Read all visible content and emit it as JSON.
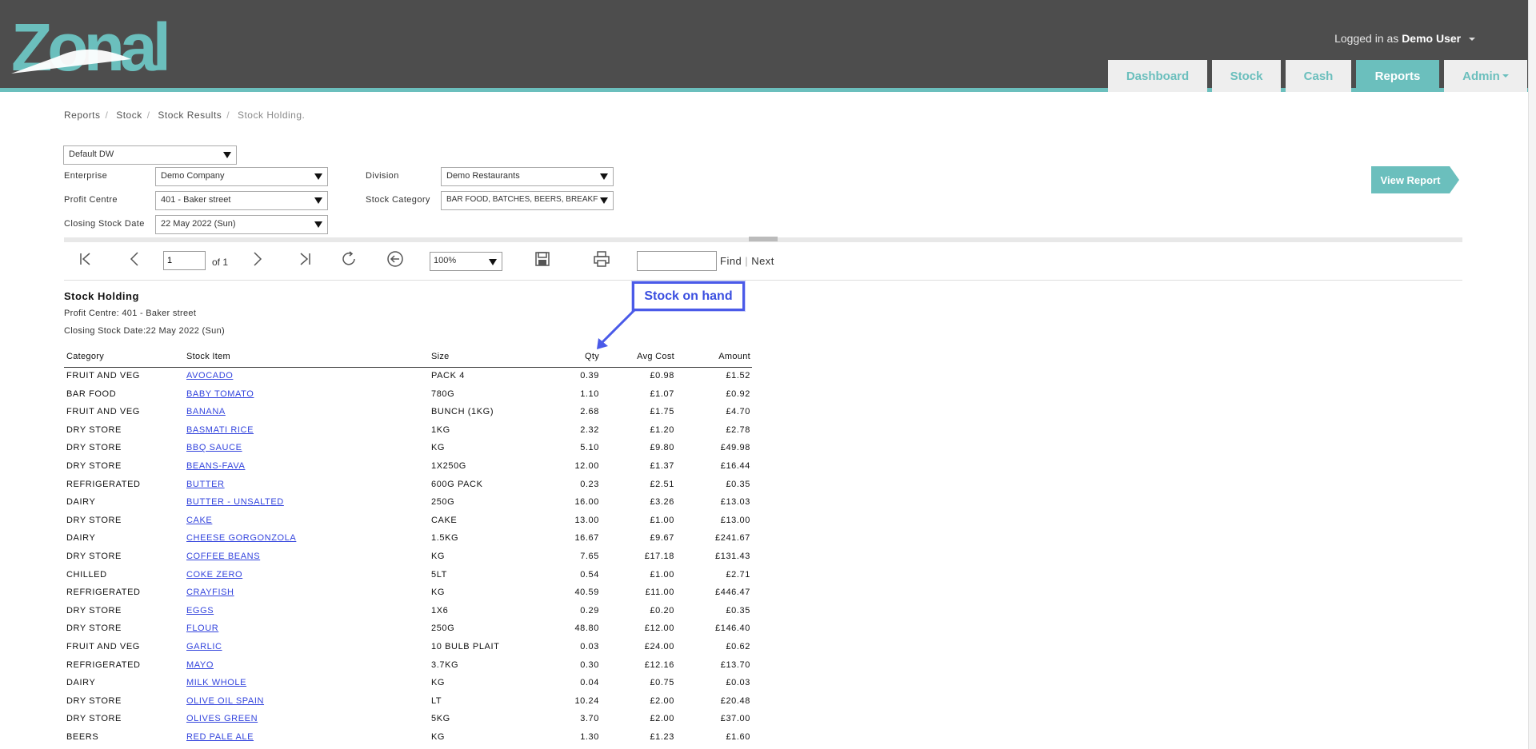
{
  "header": {
    "logo_text": "Zonal",
    "user_prefix": "Logged in as",
    "user_name": "Demo User",
    "tabs": [
      {
        "label": "Dashboard"
      },
      {
        "label": "Stock"
      },
      {
        "label": "Cash"
      },
      {
        "label": "Reports"
      },
      {
        "label": "Admin"
      }
    ]
  },
  "breadcrumb": {
    "items": [
      "Reports",
      "Stock",
      "Stock Results"
    ],
    "current": "Stock Holding."
  },
  "filters": {
    "datasource": "Default DW",
    "enterprise_label": "Enterprise",
    "enterprise_value": "Demo Company",
    "division_label": "Division",
    "division_value": "Demo Restaurants",
    "profit_centre_label": "Profit Centre",
    "profit_centre_value": "401 - Baker street",
    "stock_category_label": "Stock Category",
    "stock_category_value": "BAR FOOD, BATCHES, BEERS, BREAKF",
    "closing_date_label": "Closing Stock Date",
    "closing_date_value": "22 May 2022 (Sun)",
    "view_report_label": "View Report"
  },
  "toolbar": {
    "page_value": "1",
    "of_text": "of 1",
    "zoom_value": "100%",
    "find_value": "",
    "find_label": "Find",
    "next_label": "Next"
  },
  "report": {
    "title": "Stock Holding",
    "profit_centre_line": "Profit Centre: 401 - Baker street",
    "closing_date_line": "Closing Stock Date:22 May 2022 (Sun)",
    "columns": {
      "category": "Category",
      "item": "Stock Item",
      "size": "Size",
      "qty": "Qty",
      "avg_cost": "Avg Cost",
      "amount": "Amount"
    },
    "rows": [
      {
        "category": "FRUIT AND VEG",
        "item": "AVOCADO",
        "size": "PACK 4",
        "qty": "0.39",
        "avg_cost": "£0.98",
        "amount": "£1.52"
      },
      {
        "category": "BAR FOOD",
        "item": "BABY TOMATO",
        "size": "780G",
        "qty": "1.10",
        "avg_cost": "£1.07",
        "amount": "£0.92"
      },
      {
        "category": "FRUIT AND VEG",
        "item": "BANANA",
        "size": "BUNCH (1KG)",
        "qty": "2.68",
        "avg_cost": "£1.75",
        "amount": "£4.70"
      },
      {
        "category": "DRY STORE",
        "item": "BASMATI RICE",
        "size": "1KG",
        "qty": "2.32",
        "avg_cost": "£1.20",
        "amount": "£2.78"
      },
      {
        "category": "DRY STORE",
        "item": "BBQ SAUCE",
        "size": "KG",
        "qty": "5.10",
        "avg_cost": "£9.80",
        "amount": "£49.98"
      },
      {
        "category": "DRY STORE",
        "item": "BEANS-FAVA",
        "size": "1X250G",
        "qty": "12.00",
        "avg_cost": "£1.37",
        "amount": "£16.44"
      },
      {
        "category": "REFRIGERATED",
        "item": "BUTTER",
        "size": "600G PACK",
        "qty": "0.23",
        "avg_cost": "£2.51",
        "amount": "£0.35"
      },
      {
        "category": "DAIRY",
        "item": "BUTTER - UNSALTED",
        "size": "250G",
        "qty": "16.00",
        "avg_cost": "£3.26",
        "amount": "£13.03"
      },
      {
        "category": "DRY STORE",
        "item": "CAKE",
        "size": "CAKE",
        "qty": "13.00",
        "avg_cost": "£1.00",
        "amount": "£13.00"
      },
      {
        "category": "DAIRY",
        "item": "CHEESE GORGONZOLA",
        "size": "1.5KG",
        "qty": "16.67",
        "avg_cost": "£9.67",
        "amount": "£241.67"
      },
      {
        "category": "DRY STORE",
        "item": "COFFEE  BEANS",
        "size": "KG",
        "qty": "7.65",
        "avg_cost": "£17.18",
        "amount": "£131.43"
      },
      {
        "category": "CHILLED",
        "item": "COKE ZERO",
        "size": "5LT",
        "qty": "0.54",
        "avg_cost": "£1.00",
        "amount": "£2.71"
      },
      {
        "category": "REFRIGERATED",
        "item": "CRAYFISH",
        "size": "KG",
        "qty": "40.59",
        "avg_cost": "£11.00",
        "amount": "£446.47"
      },
      {
        "category": "DRY STORE",
        "item": "EGGS",
        "size": "1X6",
        "qty": "0.29",
        "avg_cost": "£0.20",
        "amount": "£0.35"
      },
      {
        "category": "DRY STORE",
        "item": "FLOUR",
        "size": "250G",
        "qty": "48.80",
        "avg_cost": "£12.00",
        "amount": "£146.40"
      },
      {
        "category": "FRUIT AND VEG",
        "item": "GARLIC",
        "size": "10 BULB PLAIT",
        "qty": "0.03",
        "avg_cost": "£24.00",
        "amount": "£0.62"
      },
      {
        "category": "REFRIGERATED",
        "item": "MAYO",
        "size": "3.7KG",
        "qty": "0.30",
        "avg_cost": "£12.16",
        "amount": "£13.70"
      },
      {
        "category": "DAIRY",
        "item": "MILK WHOLE",
        "size": "KG",
        "qty": "0.04",
        "avg_cost": "£0.75",
        "amount": "£0.03"
      },
      {
        "category": "DRY STORE",
        "item": "OLIVE OIL SPAIN",
        "size": "LT",
        "qty": "10.24",
        "avg_cost": "£2.00",
        "amount": "£20.48"
      },
      {
        "category": "DRY STORE",
        "item": "OLIVES GREEN",
        "size": "5KG",
        "qty": "3.70",
        "avg_cost": "£2.00",
        "amount": "£37.00"
      },
      {
        "category": "BEERS",
        "item": "RED PALE ALE",
        "size": "KG",
        "qty": "1.30",
        "avg_cost": "£1.23",
        "amount": "£1.60"
      }
    ]
  },
  "annotation": {
    "label": "Stock on hand"
  },
  "colors": {
    "header_bg": "#4d4d4d",
    "accent": "#6bbfbd",
    "link": "#3344dd",
    "annotation": "#4a5ae8"
  }
}
